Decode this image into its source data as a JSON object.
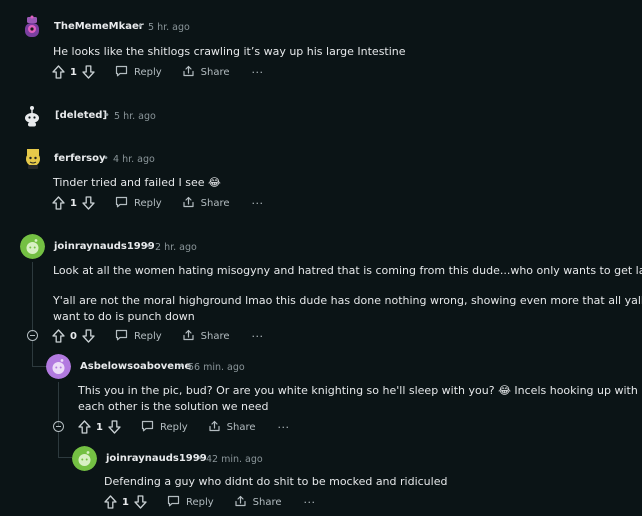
{
  "comments": [
    {
      "username": "TheMemeMkaer",
      "time": "5 hr. ago",
      "body": [
        "He looks like the shitlogs crawling it’s way up his large Intestine"
      ],
      "votes": "1",
      "reply_label": "Reply",
      "share_label": "Share",
      "more_label": "···",
      "avatar_color": "#7b3fa0"
    },
    {
      "username": "[deleted]",
      "time": "5 hr. ago",
      "avatar_color": "#e8eaec"
    },
    {
      "username": "ferfersoy",
      "time": "4 hr. ago",
      "body": [
        "Tinder tried and failed I see 😂"
      ],
      "votes": "1",
      "reply_label": "Reply",
      "share_label": "Share",
      "more_label": "···",
      "avatar_color": "#e6c94a"
    },
    {
      "username": "joinraynauds1999",
      "time": "2 hr. ago",
      "body": [
        "Look at all the women hating misogyny and hatred that is coming from this dude...who only wants to get laid",
        "Y'all are not the moral highground lmao this dude has done nothing wrong, showing even more that all yall",
        "want to do is punch down"
      ],
      "votes": "0",
      "reply_label": "Reply",
      "share_label": "Share",
      "more_label": "···",
      "avatar_color": "#74c043"
    },
    {
      "username": "Asbelowsoaboveme",
      "time": "56 min. ago",
      "body": [
        "This you in the pic, bud? Or are you white knighting so he'll sleep with you? 😂 Incels hooking up with",
        "each other is the solution we need"
      ],
      "votes": "1",
      "reply_label": "Reply",
      "share_label": "Share",
      "more_label": "···",
      "avatar_color": "#b27ae0"
    },
    {
      "username": "joinraynauds1999",
      "time": "42 min. ago",
      "body": [
        "Defending a guy who didnt do shit to be mocked and ridiculed"
      ],
      "votes": "1",
      "reply_label": "Reply",
      "share_label": "Share",
      "more_label": "···",
      "avatar_color": "#74c043"
    }
  ],
  "separator": "•"
}
